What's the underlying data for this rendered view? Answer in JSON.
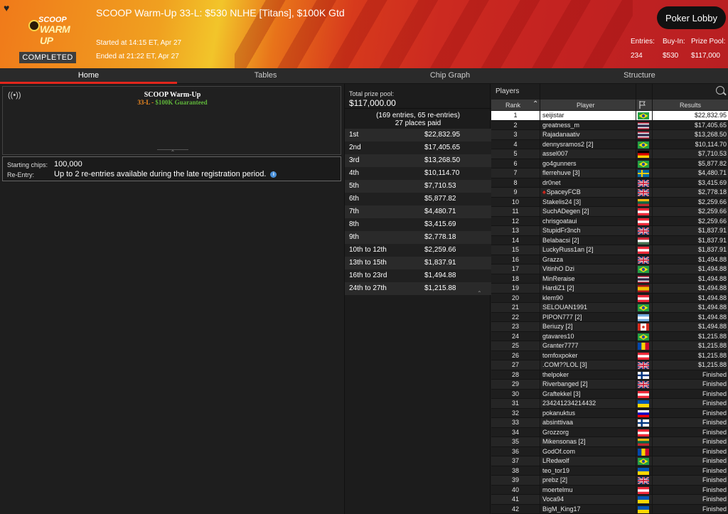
{
  "header": {
    "title": "SCOOP Warm-Up 33-L: $530 NLHE [Titans], $100K Gtd",
    "started": "Started at 14:15 ET, Apr 27",
    "ended": "Ended at 21:22 ET, Apr 27",
    "status": "COMPLETED",
    "logo_line1": "SCOOP",
    "logo_line2": "WARM UP",
    "lobby_button": "Poker Lobby",
    "stats": [
      {
        "label": "Entries:",
        "value": "234"
      },
      {
        "label": "Buy-In:",
        "value": "$530"
      },
      {
        "label": "Prize Pool:",
        "value": "$117,000"
      }
    ]
  },
  "nav": {
    "tabs": [
      "Home",
      "Tables",
      "Chip Graph",
      "Structure"
    ],
    "active": "Home"
  },
  "banner": {
    "name": "SCOOP Warm-Up",
    "code": "33-L",
    "sep": " - ",
    "guarantee": "$100K Guaranteed"
  },
  "info": {
    "chips_label": "Starting chips:",
    "chips_value": "100,000",
    "reentry_label": "Re-Entry:",
    "reentry_value": "Up to 2 re-entries available during the late registration period."
  },
  "prize": {
    "label": "Total prize pool:",
    "total": "$117,000.00",
    "entries": "(169 entries, 65 re-entries)",
    "paid": "27 places paid",
    "payouts": [
      {
        "place": "1st",
        "amount": "$22,832.95"
      },
      {
        "place": "2nd",
        "amount": "$17,405.65"
      },
      {
        "place": "3rd",
        "amount": "$13,268.50"
      },
      {
        "place": "4th",
        "amount": "$10,114.70"
      },
      {
        "place": "5th",
        "amount": "$7,710.53"
      },
      {
        "place": "6th",
        "amount": "$5,877.82"
      },
      {
        "place": "7th",
        "amount": "$4,480.71"
      },
      {
        "place": "8th",
        "amount": "$3,415.69"
      },
      {
        "place": "9th",
        "amount": "$2,778.18"
      },
      {
        "place": "10th to 12th",
        "amount": "$2,259.66"
      },
      {
        "place": "13th to 15th",
        "amount": "$1,837.91"
      },
      {
        "place": "16th to 23rd",
        "amount": "$1,494.88"
      },
      {
        "place": "24th to 27th",
        "amount": "$1,215.88"
      }
    ]
  },
  "players": {
    "title": "Players",
    "columns": {
      "rank": "Rank",
      "player": "Player",
      "results": "Results"
    },
    "rows": [
      {
        "rank": "1",
        "name": "seijistar",
        "flag": "br",
        "result": "$22,832.95"
      },
      {
        "rank": "2",
        "name": "greatness_m",
        "flag": "th",
        "result": "$17,405.65"
      },
      {
        "rank": "3",
        "name": "Rajadanaativ",
        "flag": "th",
        "result": "$13,268.50"
      },
      {
        "rank": "4",
        "name": "dennysramos2 [2]",
        "flag": "br",
        "result": "$10,114.70"
      },
      {
        "rank": "5",
        "name": "assel007",
        "flag": "de",
        "result": "$7,710.53"
      },
      {
        "rank": "6",
        "name": "go4gunners",
        "flag": "br",
        "result": "$5,877.82"
      },
      {
        "rank": "7",
        "name": "flerrehuve [3]",
        "flag": "se",
        "result": "$4,480.71"
      },
      {
        "rank": "8",
        "name": "dr0net",
        "flag": "gb",
        "result": "$3,415.69"
      },
      {
        "rank": "9",
        "name": "SpaceyFCB",
        "flag": "gb",
        "result": "$2,778.18",
        "spade": true
      },
      {
        "rank": "10",
        "name": "Stakelis24 [3]",
        "flag": "lt",
        "result": "$2,259.66"
      },
      {
        "rank": "11",
        "name": "SuchADegen [2]",
        "flag": "at",
        "result": "$2,259.66"
      },
      {
        "rank": "12",
        "name": "chrisgoataui",
        "flag": "at",
        "result": "$2,259.66"
      },
      {
        "rank": "13",
        "name": "StupidFr3nch",
        "flag": "gb",
        "result": "$1,837.91"
      },
      {
        "rank": "14",
        "name": "Belabacsi [2]",
        "flag": "hu",
        "result": "$1,837.91"
      },
      {
        "rank": "15",
        "name": "LuckyRuss1an [2]",
        "flag": "at",
        "result": "$1,837.91"
      },
      {
        "rank": "16",
        "name": "Grazza",
        "flag": "gb",
        "result": "$1,494.88"
      },
      {
        "rank": "17",
        "name": "VitinhO Dzi",
        "flag": "br",
        "result": "$1,494.88"
      },
      {
        "rank": "18",
        "name": "MinReraise",
        "flag": "th",
        "result": "$1,494.88"
      },
      {
        "rank": "19",
        "name": "HardiZ1 [2]",
        "flag": "es",
        "result": "$1,494.88"
      },
      {
        "rank": "20",
        "name": "klem90",
        "flag": "at",
        "result": "$1,494.88"
      },
      {
        "rank": "21",
        "name": "SELOUAN1991",
        "flag": "br",
        "result": "$1,494.88"
      },
      {
        "rank": "22",
        "name": "PIPON777 [2]",
        "flag": "ar",
        "result": "$1,494.88"
      },
      {
        "rank": "23",
        "name": "Beriuzy [2]",
        "flag": "ca",
        "result": "$1,494.88"
      },
      {
        "rank": "24",
        "name": "gtavares10",
        "flag": "br",
        "result": "$1,215.88"
      },
      {
        "rank": "25",
        "name": "Granter7777",
        "flag": "md",
        "result": "$1,215.88"
      },
      {
        "rank": "26",
        "name": "tomfoxpoker",
        "flag": "at",
        "result": "$1,215.88"
      },
      {
        "rank": "27",
        "name": ".COM??LOL [3]",
        "flag": "gb",
        "result": "$1,215.88"
      },
      {
        "rank": "28",
        "name": "thelpoker",
        "flag": "fi",
        "result": "Finished"
      },
      {
        "rank": "29",
        "name": "Riverbanged [2]",
        "flag": "gb",
        "result": "Finished"
      },
      {
        "rank": "30",
        "name": "Graftekkel [3]",
        "flag": "at",
        "result": "Finished"
      },
      {
        "rank": "31",
        "name": "234241234214432",
        "flag": "ua",
        "result": "Finished"
      },
      {
        "rank": "32",
        "name": "pokanuktus",
        "flag": "si",
        "result": "Finished"
      },
      {
        "rank": "33",
        "name": "absinttivaa",
        "flag": "fi",
        "result": "Finished"
      },
      {
        "rank": "34",
        "name": "Grozzorg",
        "flag": "at",
        "result": "Finished"
      },
      {
        "rank": "35",
        "name": "Mikensonas [2]",
        "flag": "lt",
        "result": "Finished"
      },
      {
        "rank": "36",
        "name": "GodOf.com",
        "flag": "md",
        "result": "Finished"
      },
      {
        "rank": "37",
        "name": "LRedwolf",
        "flag": "br",
        "result": "Finished"
      },
      {
        "rank": "38",
        "name": "teo_tor19",
        "flag": "ua",
        "result": "Finished"
      },
      {
        "rank": "39",
        "name": "prebz [2]",
        "flag": "gb",
        "result": "Finished"
      },
      {
        "rank": "40",
        "name": "moertelmu",
        "flag": "at",
        "result": "Finished"
      },
      {
        "rank": "41",
        "name": "Voca94",
        "flag": "ua",
        "result": "Finished"
      },
      {
        "rank": "42",
        "name": "BigM_King17",
        "flag": "ua",
        "result": "Finished"
      }
    ]
  }
}
